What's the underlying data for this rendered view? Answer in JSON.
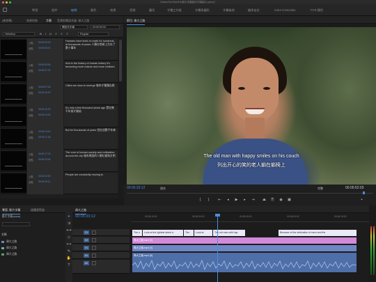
{
  "window": {
    "title": "/Users/YouTube/Dir/影片字幕製作/字幕影片.prproj *",
    "traffic_lights": [
      "#fc605c",
      "#fdbc40",
      "#34c84a"
    ]
  },
  "workspaces": [
    "學習",
    "組件",
    "編輯",
    "顏色",
    "效果",
    "音頻",
    "圖形",
    "圖形工作區",
    "字幕與圖形",
    "字幕檢視",
    "繼承自 Color Correction",
    "FCR 顏色"
  ],
  "workspaces_visible": [
    "學習",
    "組件",
    "編輯",
    "顏色",
    "效果",
    "音頻",
    "圖形",
    "字幕工作區",
    "字幕與圖形",
    "字幕檢視",
    "繼承自定",
    "Color Correction",
    "FCR 顏色"
  ],
  "active_workspace": "編輯",
  "captions_panel": {
    "tabs": [
      "(無剪輯)",
      "效果控制",
      "字幕",
      "音頻剪輯混合器: 偉大之路"
    ],
    "active_tab": "字幕",
    "format": "開放式字幕",
    "font": "Helvetica",
    "style": "Regular",
    "timecode_header": "00:00:00:00",
    "rows": [
      {
        "in": "00:00:00:00",
        "out": "00:00:03:07",
        "text": "Humans have lived on earth for hundreds of thousands of years 人類在地球上生存了數十萬年"
      },
      {
        "in": "00:00:03:08",
        "out": "00:00:07:15",
        "text": "And in the history of human history it's becoming more mature and more civilized"
      },
      {
        "in": "00:00:07:16",
        "out": "00:00:10:22",
        "text": "Cities are slow to emerge 城市才慢慢出現"
      },
      {
        "in": "00:00:10:23",
        "out": "00:00:14:00",
        "text": "It's only a few thousand years ago 是在幾千年前才開始"
      },
      {
        "in": "00:00:14:01",
        "out": "00:00:17:18",
        "text": "But for thousands of years 但在這數千年來"
      },
      {
        "in": "00:00:17:19",
        "out": "00:00:22:04",
        "text": "The core of human society and civilization around the city 城市周圍的人類社會和文明"
      },
      {
        "in": "00:00:22:05",
        "out": "00:00:25:11",
        "text": "People are constantly moving to"
      }
    ],
    "in_label": "入點",
    "out_label": "出點"
  },
  "program_monitor": {
    "tab_label": "節目: 偉大之路",
    "subtitle_en": "The old man with happy smiles on his couch",
    "subtitle_cn": "列出开心的笑的老人躺在躺椅上",
    "timecode": "00:05:33:12",
    "duration": "00:05:52:03",
    "fit": "適合",
    "quality": "完整"
  },
  "project_panel": {
    "tabs": [
      "專案: 影片字幕",
      "媒體瀏覽器"
    ],
    "file": "影片字幕.prproj",
    "items": [
      "名稱",
      "偉大之路",
      "偉大之路",
      "偉大之路"
    ]
  },
  "timeline": {
    "tab_label": "偉大之路",
    "timecode": "00:05:33:12",
    "ruler": [
      "00:05:15:00",
      "00:05:30:00",
      "00:05:45:00",
      "00:06:00:00",
      "00:06:15:00"
    ],
    "tracks": [
      {
        "name": "C1",
        "label": "字幕"
      },
      {
        "name": "V2",
        "label": "V2"
      },
      {
        "name": "V1",
        "label": "V1"
      },
      {
        "name": "A1",
        "label": "A1"
      },
      {
        "name": "A2",
        "label": "A2"
      }
    ],
    "caption_clips": [
      "The o",
      "Look at the lightest street a",
      "The",
      "Look at",
      "The old man with hap",
      "Because of the dedication of each and the"
    ],
    "video_clip_1": "偉大之路.mp4 [V]",
    "video_clip_2": "偉大之路.mp4 [V]",
    "audio_clip": "偉大之路.mp4 [A]",
    "colors": {
      "caption": "#e9e9f7",
      "video_pink": "#d38ad8",
      "video_blue": "#6f86c4",
      "audio": "#4f6fa8"
    }
  },
  "tools": [
    "selection",
    "track-select",
    "ripple-edit",
    "razor",
    "slip",
    "pen",
    "hand",
    "type"
  ]
}
